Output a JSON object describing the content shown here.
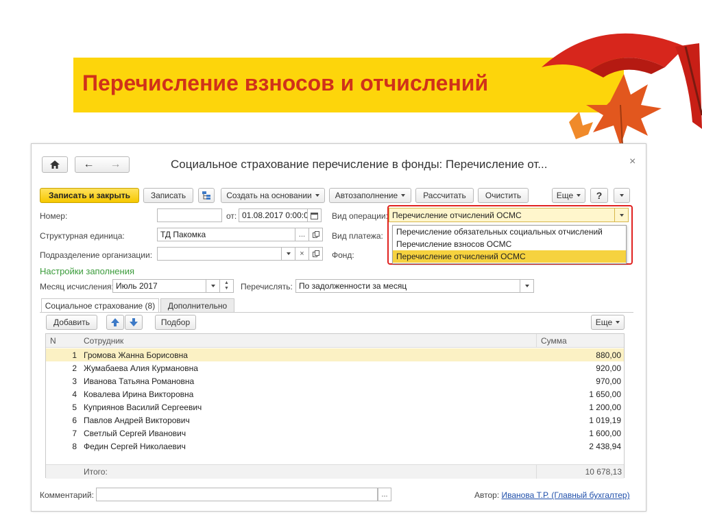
{
  "slide": {
    "title": "Перечисление взносов и отчислений"
  },
  "window": {
    "title": "Социальное страхование перечисление в фонды: Перечисление от...",
    "close_icon": "close-icon"
  },
  "toolbar": {
    "save_close": "Записать и закрыть",
    "save": "Записать",
    "create_based": "Создать на основании",
    "autofill": "Автозаполнение",
    "calculate": "Рассчитать",
    "clear": "Очистить",
    "more": "Еще",
    "help": "?"
  },
  "form": {
    "number_label": "Номер:",
    "number_value": "",
    "from_label": "от:",
    "date_value": "01.08.2017 0:00:00",
    "operation_label": "Вид операции:",
    "operation_value": "Перечисление отчислений ОСМС",
    "unit_label": "Структурная единица:",
    "unit_value": "ТД Пакомка",
    "payment_label": "Вид платежа:",
    "division_label": "Подразделение организации:",
    "division_value": "",
    "fund_label": "Фонд:",
    "fill_settings": "Настройки заполнения",
    "month_label": "Месяц исчисления:",
    "month_value": "Июль 2017",
    "transfer_label": "Перечислять:",
    "transfer_value": "По задолженности за месяц"
  },
  "operation_options": [
    "Перечисление обязательных социальных отчислений",
    "Перечисление взносов ОСМС",
    "Перечисление отчислений ОСМС"
  ],
  "tabs": [
    "Социальное страхование (8)",
    "Дополнительно"
  ],
  "table_toolbar": {
    "add": "Добавить",
    "pick": "Подбор",
    "more": "Еще"
  },
  "table": {
    "columns": [
      "N",
      "Сотрудник",
      "Сумма"
    ],
    "rows": [
      {
        "n": "1",
        "employee": "Громова Жанна Борисовна",
        "sum": "880,00"
      },
      {
        "n": "2",
        "employee": "Жумабаева Алия Курмановна",
        "sum": "920,00"
      },
      {
        "n": "3",
        "employee": "Иванова Татьяна Романовна",
        "sum": "970,00"
      },
      {
        "n": "4",
        "employee": "Ковалева Ирина Викторовна",
        "sum": "1 650,00"
      },
      {
        "n": "5",
        "employee": "Куприянов Василий Сергеевич",
        "sum": "1 200,00"
      },
      {
        "n": "6",
        "employee": "Павлов Андрей Викторович",
        "sum": "1 019,19"
      },
      {
        "n": "7",
        "employee": "Светлый Сергей Иванович",
        "sum": "1 600,00"
      },
      {
        "n": "8",
        "employee": "Федин Сергей Николаевич",
        "sum": "2 438,94"
      }
    ],
    "total_label": "Итого:",
    "total_value": "10 678,13"
  },
  "footer": {
    "comment_label": "Комментарий:",
    "comment_value": "",
    "author_label": "Автор:",
    "author_value": "Иванова Т.Р. (Главный бухгалтер)"
  },
  "colors": {
    "banner": "#fdd50b",
    "title": "#d0311a",
    "accent_green": "#3a9b3a",
    "highlight_red": "#e0211f",
    "selected_row": "#fbf1c4"
  }
}
